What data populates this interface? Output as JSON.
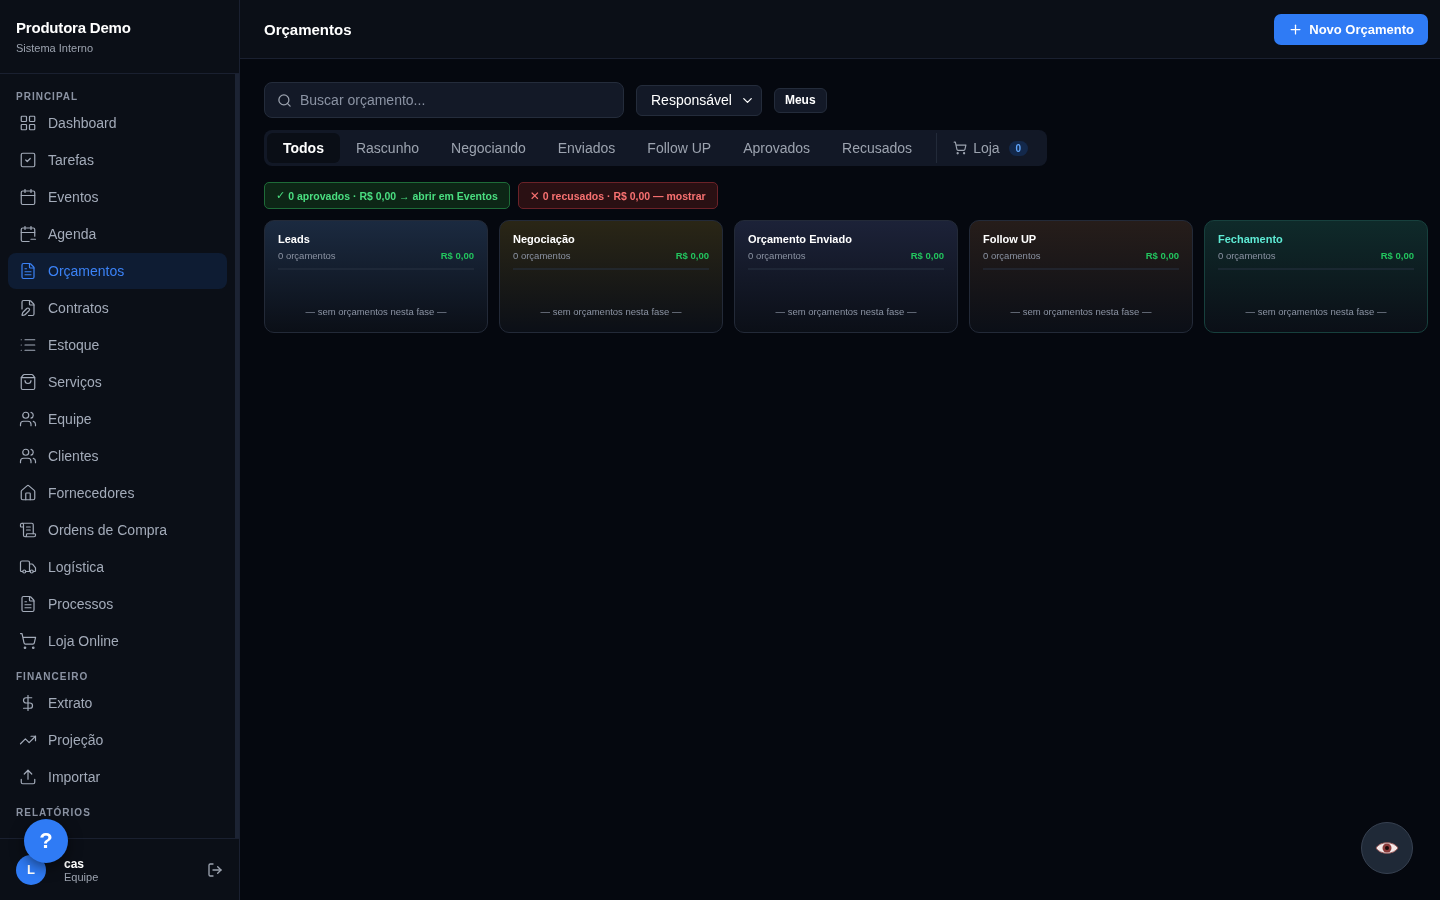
{
  "brand": {
    "title": "Produtora Demo",
    "subtitle": "Sistema Interno"
  },
  "sidebar": {
    "sections": [
      {
        "label": "PRINCIPAL",
        "items": [
          {
            "label": "Dashboard",
            "selected": false
          },
          {
            "label": "Tarefas",
            "selected": false
          },
          {
            "label": "Eventos",
            "selected": false
          },
          {
            "label": "Agenda",
            "selected": false
          },
          {
            "label": "Orçamentos",
            "selected": true
          },
          {
            "label": "Contratos",
            "selected": false
          },
          {
            "label": "Estoque",
            "selected": false
          },
          {
            "label": "Serviços",
            "selected": false
          },
          {
            "label": "Equipe",
            "selected": false
          },
          {
            "label": "Clientes",
            "selected": false
          },
          {
            "label": "Fornecedores",
            "selected": false
          },
          {
            "label": "Ordens de Compra",
            "selected": false
          },
          {
            "label": "Logística",
            "selected": false
          },
          {
            "label": "Processos",
            "selected": false
          },
          {
            "label": "Loja Online",
            "selected": false
          }
        ]
      },
      {
        "label": "FINANCEIRO",
        "items": [
          {
            "label": "Extrato",
            "selected": false
          },
          {
            "label": "Projeção",
            "selected": false
          },
          {
            "label": "Importar",
            "selected": false
          }
        ]
      },
      {
        "label": "RELATÓRIOS"
      }
    ],
    "user": {
      "avatar": "L",
      "name": "cas",
      "role": "Equipe"
    }
  },
  "header": {
    "title": "Orçamentos",
    "new_button": "Novo Orçamento"
  },
  "filters": {
    "search_placeholder": "Buscar orçamento...",
    "responsible": "Responsável",
    "mine": "Meus"
  },
  "tabs": [
    {
      "label": "Todos",
      "selected": true
    },
    {
      "label": "Rascunho",
      "selected": false
    },
    {
      "label": "Negociando",
      "selected": false
    },
    {
      "label": "Enviados",
      "selected": false
    },
    {
      "label": "Follow UP",
      "selected": false
    },
    {
      "label": "Aprovados",
      "selected": false
    },
    {
      "label": "Recusados",
      "selected": false
    }
  ],
  "store_tab": {
    "label": "Loja",
    "count": "0",
    "selected": false
  },
  "summary": [
    {
      "kind": "approved",
      "icon": "✓",
      "text": "0 aprovados · R$ 0,00 → abrir em Eventos"
    },
    {
      "kind": "rejected",
      "icon": "✕",
      "text": "0 recusados · R$ 0,00 — mostrar"
    }
  ],
  "stages": [
    {
      "title": "Leads",
      "count": "0 orçamentos",
      "total": "R$ 0,00",
      "empty": "— sem orçamentos nesta fase —",
      "color": "#1b2a40",
      "highlight": false
    },
    {
      "title": "Negociação",
      "count": "0 orçamentos",
      "total": "R$ 0,00",
      "empty": "— sem orçamentos nesta fase —",
      "color": "#2a2616",
      "highlight": false
    },
    {
      "title": "Orçamento Enviado",
      "count": "0 orçamentos",
      "total": "R$ 0,00",
      "empty": "— sem orçamentos nesta fase —",
      "color": "#1c2238",
      "highlight": false
    },
    {
      "title": "Follow UP",
      "count": "0 orçamentos",
      "total": "R$ 0,00",
      "empty": "— sem orçamentos nesta fase —",
      "color": "#261d1a",
      "highlight": false
    },
    {
      "title": "Fechamento",
      "count": "0 orçamentos",
      "total": "R$ 0,00",
      "empty": "— sem orçamentos nesta fase —",
      "color": "#0f2a2a",
      "highlight": true
    }
  ],
  "help": {
    "label": "?"
  }
}
